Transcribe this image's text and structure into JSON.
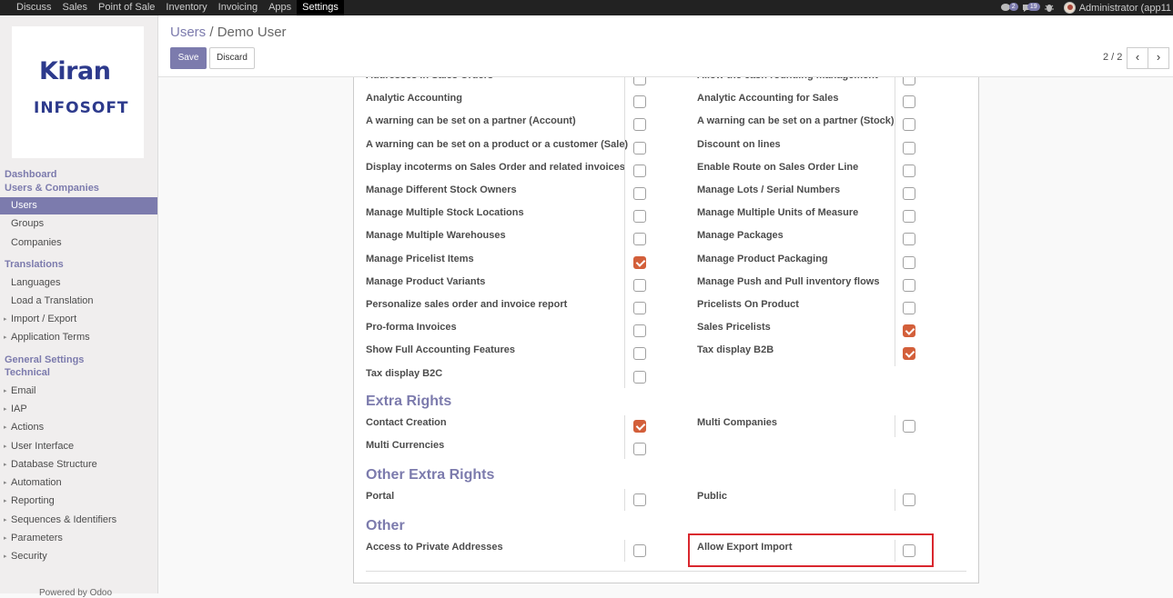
{
  "topbar": {
    "menu": [
      "Discuss",
      "Sales",
      "Point of Sale",
      "Inventory",
      "Invoicing",
      "Apps",
      "Settings"
    ],
    "active": "Settings",
    "chat_badge": "2",
    "activity_badge": "19",
    "user": "Administrator (app11"
  },
  "sidebar": {
    "logo_line1": "Kiran",
    "logo_line2": "INFOSOFT",
    "sections": {
      "dashboard": "Dashboard",
      "users_companies": "Users & Companies",
      "translations": "Translations",
      "general_settings": "General Settings",
      "technical": "Technical"
    },
    "items": {
      "users": "Users",
      "groups": "Groups",
      "companies": "Companies",
      "languages": "Languages",
      "load_translation": "Load a Translation",
      "import_export": "Import / Export",
      "application_terms": "Application Terms",
      "email": "Email",
      "iap": "IAP",
      "actions": "Actions",
      "user_interface": "User Interface",
      "database_structure": "Database Structure",
      "automation": "Automation",
      "reporting": "Reporting",
      "sequences": "Sequences & Identifiers",
      "parameters": "Parameters",
      "security": "Security"
    },
    "powered": "Powered by Odoo"
  },
  "control": {
    "breadcrumb_parent": "Users",
    "breadcrumb_sep": "/",
    "breadcrumb_current": "Demo User",
    "save": "Save",
    "discard": "Discard",
    "pager": "2 / 2",
    "prev": "‹",
    "next": "›"
  },
  "form": {
    "rows": [
      {
        "left": "Addresses in Sales Orders",
        "left_checked": false,
        "right": "Allow the cash rounding management",
        "right_checked": false
      },
      {
        "left": "Analytic Accounting",
        "left_checked": false,
        "right": "Analytic Accounting for Sales",
        "right_checked": false
      },
      {
        "left": "A warning can be set on a partner (Account)",
        "left_checked": false,
        "right": "A warning can be set on a partner (Stock)",
        "right_checked": false
      },
      {
        "left": "A warning can be set on a product or a customer (Sale)",
        "left_checked": false,
        "right": "Discount on lines",
        "right_checked": false
      },
      {
        "left": "Display incoterms on Sales Order and related invoices",
        "left_checked": false,
        "right": "Enable Route on Sales Order Line",
        "right_checked": false
      },
      {
        "left": "Manage Different Stock Owners",
        "left_checked": false,
        "right": "Manage Lots / Serial Numbers",
        "right_checked": false
      },
      {
        "left": "Manage Multiple Stock Locations",
        "left_checked": false,
        "right": "Manage Multiple Units of Measure",
        "right_checked": false
      },
      {
        "left": "Manage Multiple Warehouses",
        "left_checked": false,
        "right": "Manage Packages",
        "right_checked": false
      },
      {
        "left": "Manage Pricelist Items",
        "left_checked": true,
        "right": "Manage Product Packaging",
        "right_checked": false
      },
      {
        "left": "Manage Product Variants",
        "left_checked": false,
        "right": "Manage Push and Pull inventory flows",
        "right_checked": false
      },
      {
        "left": "Personalize sales order and invoice report",
        "left_checked": false,
        "right": "Pricelists On Product",
        "right_checked": false
      },
      {
        "left": "Pro-forma Invoices",
        "left_checked": false,
        "right": "Sales Pricelists",
        "right_checked": true
      },
      {
        "left": "Show Full Accounting Features",
        "left_checked": false,
        "right": "Tax display B2B",
        "right_checked": true
      },
      {
        "left": "Tax display B2C",
        "left_checked": false,
        "right": null,
        "right_checked": null
      }
    ],
    "extra_rights_title": "Extra Rights",
    "extra_rows": [
      {
        "left": "Contact Creation",
        "left_checked": true,
        "right": "Multi Companies",
        "right_checked": false
      },
      {
        "left": "Multi Currencies",
        "left_checked": false,
        "right": null,
        "right_checked": null
      }
    ],
    "other_extra_title": "Other Extra Rights",
    "other_extra_rows": [
      {
        "left": "Portal",
        "left_checked": false,
        "right": "Public",
        "right_checked": false
      }
    ],
    "other_title": "Other",
    "other_rows": [
      {
        "left": "Access to Private Addresses",
        "left_checked": false,
        "right": "Allow Export Import",
        "right_checked": false
      }
    ]
  },
  "colors": {
    "accent": "#7c7bad",
    "checked": "#d35f3a",
    "highlight": "#d9272e"
  }
}
